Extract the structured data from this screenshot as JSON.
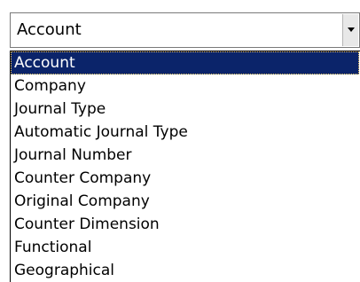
{
  "combobox": {
    "selected_value": "Account",
    "dropdown_icon": "chevron-down-icon"
  },
  "dropdown_list": {
    "items": [
      "Account",
      "Company",
      "Journal Type",
      "Automatic Journal Type",
      "Journal Number",
      "Counter Company",
      "Original Company",
      "Counter Dimension",
      "Functional",
      "Geographical"
    ],
    "highlighted_index": 0,
    "highlight_color": "#0b246a"
  }
}
